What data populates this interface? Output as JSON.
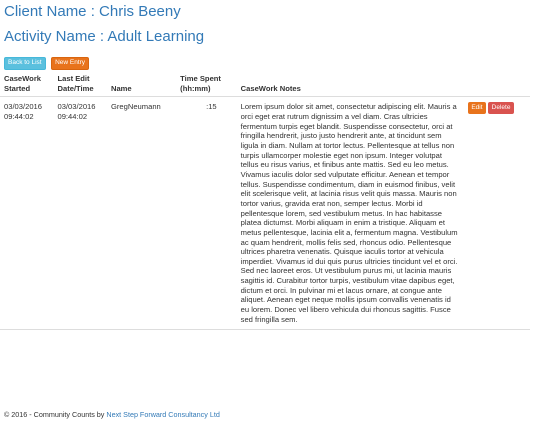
{
  "client": {
    "label": "Client Name : Chris Beeny"
  },
  "activity": {
    "label": "Activity Name : Adult Learning"
  },
  "toolbar": {
    "back_label": "Back to List",
    "new_label": "New Entry"
  },
  "table": {
    "headers": {
      "started": "CaseWork Started",
      "last_edit": "Last Edit Date/Time",
      "name": "Name",
      "time": "Time Spent (hh:mm)",
      "notes": "CaseWork Notes"
    },
    "rows": [
      {
        "started_date": "03/03/2016",
        "started_time": "09:44:02",
        "edit_date": "03/03/2016",
        "edit_time": "09:44:02",
        "name": "GregNeumann",
        "time": ":15",
        "notes": "Lorem ipsum dolor sit amet, consectetur adipiscing elit. Mauris a orci eget erat rutrum dignissim a vel diam. Cras ultricies fermentum turpis eget blandit. Suspendisse consectetur, orci at fringilla hendrerit, justo justo hendrerit ante, at tincidunt sem ligula in diam. Nullam at tortor lectus. Pellentesque at tellus non turpis ullamcorper molestie eget non ipsum. Integer volutpat tellus eu risus varius, et finibus ante mattis. Sed eu leo metus. Vivamus iaculis dolor sed vulputate efficitur. Aenean et tempor tellus. Suspendisse condimentum, diam in euismod finibus, velit elit scelerisque velit, at lacinia risus velit quis massa. Mauris non tortor varius, gravida erat non, semper lectus. Morbi id pellentesque lorem, sed vestibulum metus. In hac habitasse platea dictumst. Morbi aliquam in enim a tristique. Aliquam et metus pellentesque, lacinia elit a, fermentum magna. Vestibulum ac quam hendrerit, mollis felis sed, rhoncus odio. Pellentesque ultrices pharetra venenatis. Quisque iaculis tortor at vehicula imperdiet. Vivamus id dui quis purus ultricies tincidunt vel et orci. Sed nec laoreet eros. Ut vestibulum purus mi, ut lacinia mauris sagittis id. Curabitur tortor turpis, vestibulum vitae dapibus eget, dictum et orci. In pulvinar mi et lacus ornare, at congue ante aliquet. Aenean eget neque mollis ipsum convallis venenatis id eu lorem. Donec vel libero vehicula dui rhoncus sagittis. Fusce sed fringilla sem.",
        "edit_label": "Edit",
        "delete_label": "Delete"
      }
    ]
  },
  "footer": {
    "prefix": "© 2016 - Community Counts by ",
    "link": "Next Step Forward Consultancy Ltd"
  },
  "colors": {
    "heading": "#337ab7",
    "back_button": "#5bc0de",
    "new_button": "#e8731c",
    "edit_button": "#e8731c",
    "delete_button": "#d9534f"
  }
}
